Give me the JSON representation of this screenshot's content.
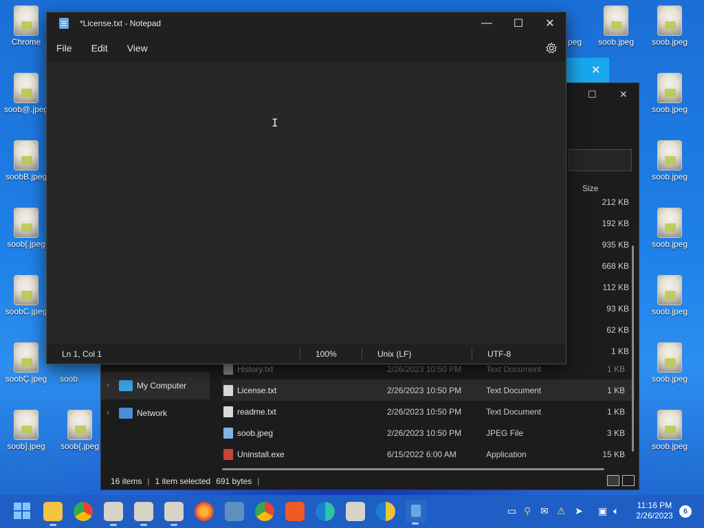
{
  "desktop": {
    "icons_left": [
      {
        "label": "soob@.jpeg"
      },
      {
        "label": "soobB.jpeg"
      },
      {
        "label": "soob[.jpeg"
      },
      {
        "label": "soobC.jpeg"
      },
      {
        "label": "soobÇ.jpeg"
      },
      {
        "label": "soob].jpeg"
      }
    ],
    "icons_right": [
      {
        "label": "soob.jpeg"
      },
      {
        "label": "soob.jpeg"
      },
      {
        "label": "soob.jpeg"
      },
      {
        "label": "soob.jpeg"
      },
      {
        "label": "soob.jpeg"
      },
      {
        "label": "soob.jpeg"
      },
      {
        "label": "soob.jpeg"
      }
    ],
    "icon_col2_right": {
      "label": "soob.jpeg"
    },
    "icon_partial_top": {
      "label": "Chrome"
    },
    "icon_bottom_2": {
      "label": "soob{.jpeg"
    },
    "icon_partial_mid": {
      "label": "soob"
    },
    "icon_partial_peg": {
      "label": "peg"
    }
  },
  "notepad": {
    "title": "*License.txt - Notepad",
    "menu": [
      "File",
      "Edit",
      "View"
    ],
    "status": {
      "position": "Ln 1, Col 1",
      "zoom": "100%",
      "line_ending": "Unix (LF)",
      "encoding": "UTF-8"
    }
  },
  "explorer": {
    "size_header": "Size",
    "hidden_sizes": [
      "212 KB",
      "192 KB",
      "935 KB",
      "668 KB",
      "112 KB",
      "93 KB",
      "62 KB",
      "1 KB"
    ],
    "nav": [
      {
        "label": "My Computer"
      },
      {
        "label": "Network"
      }
    ],
    "files": [
      {
        "name": "History.txt",
        "date": "2/26/2023 10:50 PM",
        "type": "Text Document",
        "size": "1 KB"
      },
      {
        "name": "License.txt",
        "date": "2/26/2023 10:50 PM",
        "type": "Text Document",
        "size": "1 KB"
      },
      {
        "name": "readme.txt",
        "date": "2/26/2023 10:50 PM",
        "type": "Text Document",
        "size": "1 KB"
      },
      {
        "name": "soob.jpeg",
        "date": "2/26/2023 10:50 PM",
        "type": "JPEG File",
        "size": "3 KB"
      },
      {
        "name": "Uninstall.exe",
        "date": "6/15/2022 6:00 AM",
        "type": "Application",
        "size": "15 KB"
      }
    ],
    "status": {
      "items": "16 items",
      "selected": "1 item selected",
      "bytes": "691 bytes"
    }
  },
  "taskbar": {
    "clock_time": "11:16 PM",
    "clock_date": "2/26/2023",
    "notification_count": "6"
  }
}
